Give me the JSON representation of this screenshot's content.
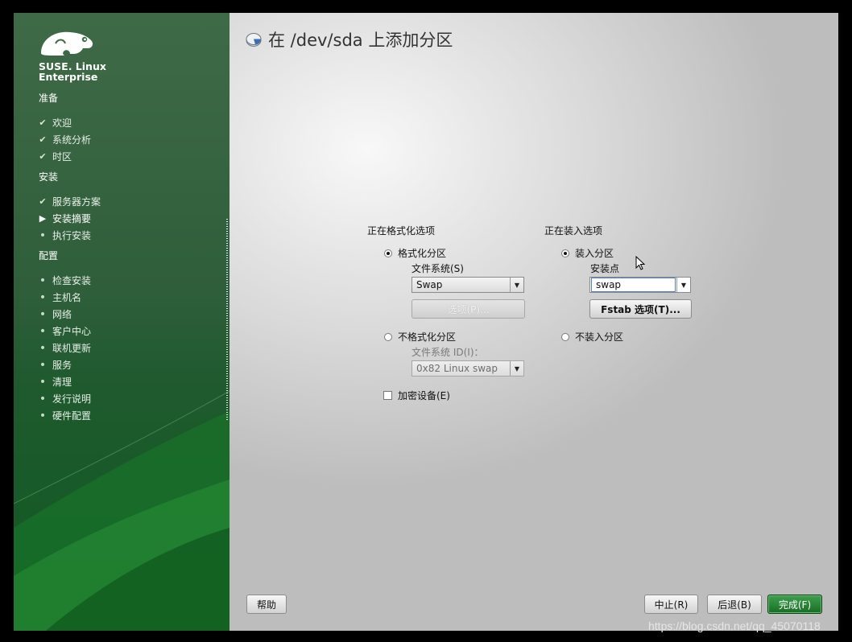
{
  "brand": {
    "line1": "SUSE. Linux",
    "line2": "Enterprise"
  },
  "sidebar": {
    "sections": [
      {
        "label": "准备",
        "items": [
          {
            "label": "欢迎",
            "state": "done"
          },
          {
            "label": "系统分析",
            "state": "done"
          },
          {
            "label": "时区",
            "state": "done"
          }
        ]
      },
      {
        "label": "安装",
        "items": [
          {
            "label": "服务器方案",
            "state": "done"
          },
          {
            "label": "安装摘要",
            "state": "current"
          },
          {
            "label": "执行安装",
            "state": "pending"
          }
        ]
      },
      {
        "label": "配置",
        "items": [
          {
            "label": "检查安装",
            "state": "pending"
          },
          {
            "label": "主机名",
            "state": "pending"
          },
          {
            "label": "网络",
            "state": "pending"
          },
          {
            "label": "客户中心",
            "state": "pending"
          },
          {
            "label": "联机更新",
            "state": "pending"
          },
          {
            "label": "服务",
            "state": "pending"
          },
          {
            "label": "清理",
            "state": "pending"
          },
          {
            "label": "发行说明",
            "state": "pending"
          },
          {
            "label": "硬件配置",
            "state": "pending"
          }
        ]
      }
    ]
  },
  "page": {
    "title": "在 /dev/sda 上添加分区"
  },
  "format": {
    "group_label": "正在格式化选项",
    "format_radio": "格式化分区",
    "filesystem_label": "文件系统(S)",
    "filesystem_value": "Swap",
    "options_button": "选项(P)...",
    "noformat_radio": "不格式化分区",
    "fsid_label": "文件系统 ID(I)：",
    "fsid_value": "0x82 Linux swap",
    "encrypt_label": "加密设备(E)"
  },
  "mount": {
    "group_label": "正在装入选项",
    "mount_radio": "装入分区",
    "mountpoint_label": "安装点",
    "mountpoint_value": "swap",
    "fstab_button": "Fstab 选项(T)...",
    "nomount_radio": "不装入分区"
  },
  "footer": {
    "help": "帮助",
    "abort": "中止(R)",
    "back": "后退(B)",
    "finish": "完成(F)"
  },
  "watermark": "https://blog.csdn.net/qq_45070118",
  "colors": {
    "accent_green": "#176e24",
    "sidebar_green": "#2f5e3b"
  }
}
